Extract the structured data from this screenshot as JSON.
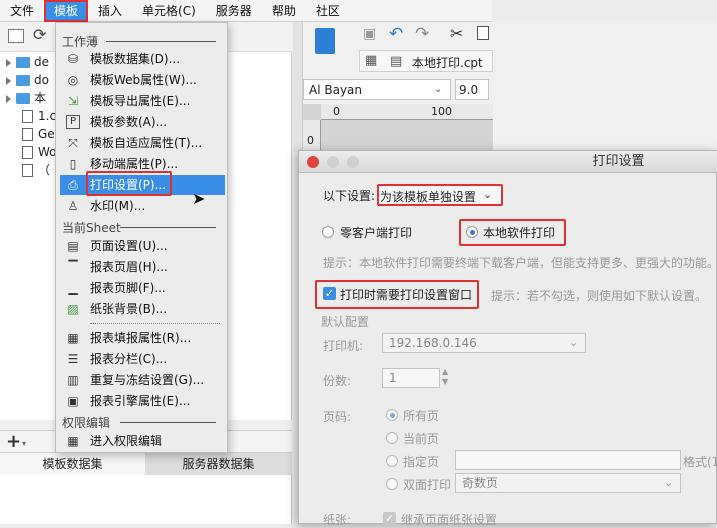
{
  "menubar": [
    "文件",
    "模板",
    "插入",
    "单元格(C)",
    "服务器",
    "帮助",
    "社区"
  ],
  "tree": {
    "rows": [
      {
        "name": "de",
        "type": "folder"
      },
      {
        "name": "do",
        "type": "folder"
      },
      {
        "name": "本",
        "type": "folder"
      },
      {
        "name": "1.c",
        "type": "file"
      },
      {
        "name": "Ge",
        "type": "file"
      },
      {
        "name": "Wo",
        "type": "file"
      },
      {
        "name": "（",
        "type": "file"
      }
    ]
  },
  "left_tabs": [
    "模板数据集",
    "服务器数据集"
  ],
  "menu": {
    "sections": {
      "workbook": "工作薄",
      "sheet": "当前Sheet",
      "permission": "权限编辑"
    },
    "workbook_items": [
      "模板数据集(D)...",
      "模板Web属性(W)...",
      "模板导出属性(E)...",
      "模板参数(A)...",
      "模板自适应属性(T)...",
      "移动端属性(P)...",
      "打印设置(P)...",
      "水印(M)..."
    ],
    "sheet_items": [
      "页面设置(U)...",
      "报表页眉(H)...",
      "报表页脚(F)...",
      "纸张背景(B)..."
    ],
    "sheet_items2": [
      "报表填报属性(R)...",
      "报表分栏(C)...",
      "重复与冻结设置(G)...",
      "报表引擎属性(E)..."
    ],
    "permission_items": [
      "进入权限编辑"
    ]
  },
  "designer": {
    "tab_file": "本地打印.cpt",
    "font": "Al Bayan",
    "font_size": "9.0",
    "ruler_0": "0",
    "ruler_100": "100",
    "vruler_0": "0"
  },
  "dialog": {
    "title": "打印设置",
    "setting_label": "以下设置:",
    "setting_value": "为该模板单独设置",
    "opt_zero_client": "零客户端打印",
    "opt_local": "本地软件打印",
    "hint_local": "提示：本地软件打印需要终端下载客户端，但能支持更多、更强大的功能。",
    "need_dialog": "打印时需要打印设置窗口",
    "hint_default": "提示：若不勾选，则使用如下默认设置。",
    "default_config": "默认配置",
    "printer_label": "打印机:",
    "printer_value": "192.168.0.146",
    "copies_label": "份数:",
    "copies_value": "1",
    "pages_label": "页码:",
    "page_all": "所有页",
    "page_current": "当前页",
    "page_specified": "指定页",
    "page_format": "格式(1",
    "duplex": "双面打印",
    "duplex_value": "奇数页",
    "paper_label": "纸张:",
    "paper_inherit": "继承页面纸张设置"
  }
}
